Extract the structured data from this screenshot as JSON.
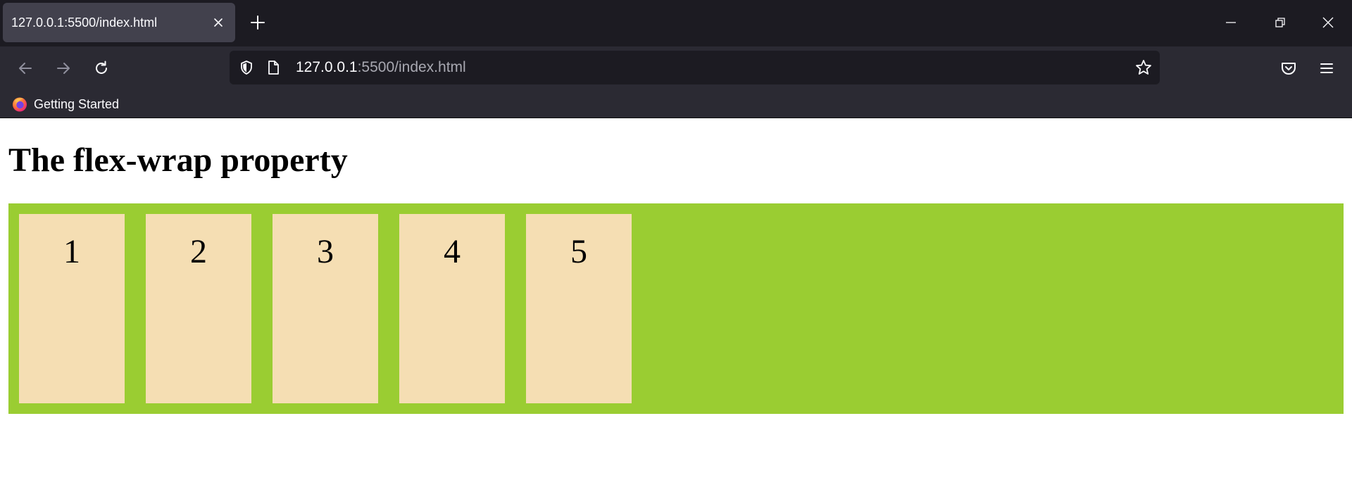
{
  "browser": {
    "tab": {
      "title": "127.0.0.1:5500/index.html"
    },
    "url": {
      "host": "127.0.0.1",
      "rest": ":5500/index.html"
    },
    "bookmarks": [
      {
        "label": "Getting Started",
        "icon": "firefox-icon"
      }
    ],
    "icons": {
      "tab_close": "close-icon",
      "new_tab": "plus-icon",
      "minimize": "minimize-icon",
      "restore": "restore-icon",
      "close": "close-icon",
      "back": "arrow-left-icon",
      "forward": "arrow-right-icon",
      "reload": "reload-icon",
      "tracking": "shield-icon",
      "page_info": "page-icon",
      "bookmark_star": "star-icon",
      "pocket": "pocket-icon",
      "menu": "hamburger-icon"
    },
    "colors": {
      "tabbar_bg": "#1c1b22",
      "toolbar_bg": "#2b2a33",
      "active_tab_bg": "#42414d",
      "urlbar_bg": "#1c1b22"
    }
  },
  "page": {
    "heading": "The flex-wrap property",
    "flex_items": [
      "1",
      "2",
      "3",
      "4",
      "5"
    ],
    "colors": {
      "container_bg": "#9acd32",
      "item_bg": "#f5deb3"
    }
  }
}
